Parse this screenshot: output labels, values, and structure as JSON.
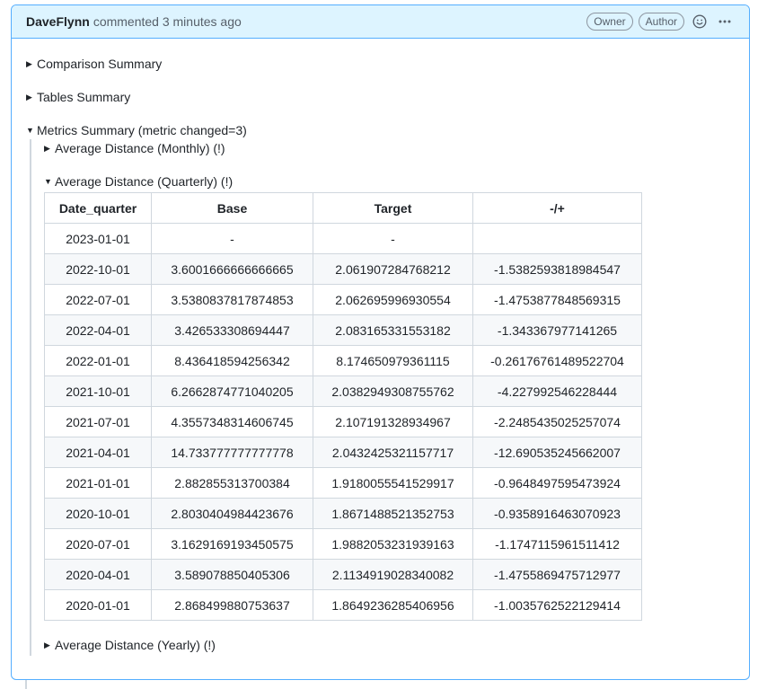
{
  "comment": {
    "author": "DaveFlynn",
    "meta": "commented 3 minutes ago",
    "badges": [
      "Owner",
      "Author"
    ],
    "emoji_icon": "smiley-icon",
    "more_icon": "kebab-horizontal-icon"
  },
  "sections": {
    "comparison": "Comparison Summary",
    "tables": "Tables Summary",
    "metrics": "Metrics Summary (metric changed=3)"
  },
  "metrics": {
    "monthly": "Average Distance (Monthly) (!)",
    "quarterly": "Average Distance (Quarterly) (!)",
    "yearly": "Average Distance (Yearly) (!)"
  },
  "table": {
    "headers": [
      "Date_quarter",
      "Base",
      "Target",
      "-/+"
    ],
    "rows": [
      [
        "2023-01-01",
        "-",
        "-",
        ""
      ],
      [
        "2022-10-01",
        "3.6001666666666665",
        "2.061907284768212",
        "-1.5382593818984547"
      ],
      [
        "2022-07-01",
        "3.5380837817874853",
        "2.062695996930554",
        "-1.4753877848569315"
      ],
      [
        "2022-04-01",
        "3.426533308694447",
        "2.083165331553182",
        "-1.343367977141265"
      ],
      [
        "2022-01-01",
        "8.436418594256342",
        "8.174650979361115",
        "-0.26176761489522704"
      ],
      [
        "2021-10-01",
        "6.2662874771040205",
        "2.0382949308755762",
        "-4.227992546228444"
      ],
      [
        "2021-07-01",
        "4.3557348314606745",
        "2.107191328934967",
        "-2.2485435025257074"
      ],
      [
        "2021-04-01",
        "14.733777777777778",
        "2.0432425321157717",
        "-12.690535245662007"
      ],
      [
        "2021-01-01",
        "2.882855313700384",
        "1.9180055541529917",
        "-0.9648497595473924"
      ],
      [
        "2020-10-01",
        "2.8030404984423676",
        "1.8671488521352753",
        "-0.9358916463070923"
      ],
      [
        "2020-07-01",
        "3.1629169193450575",
        "1.9882053231939163",
        "-1.1747115961511412"
      ],
      [
        "2020-04-01",
        "3.589078850405306",
        "2.1134919028340082",
        "-1.4755869475712977"
      ],
      [
        "2020-01-01",
        "2.868499880753637",
        "1.8649236285406956",
        "-1.0035762522129414"
      ]
    ]
  }
}
